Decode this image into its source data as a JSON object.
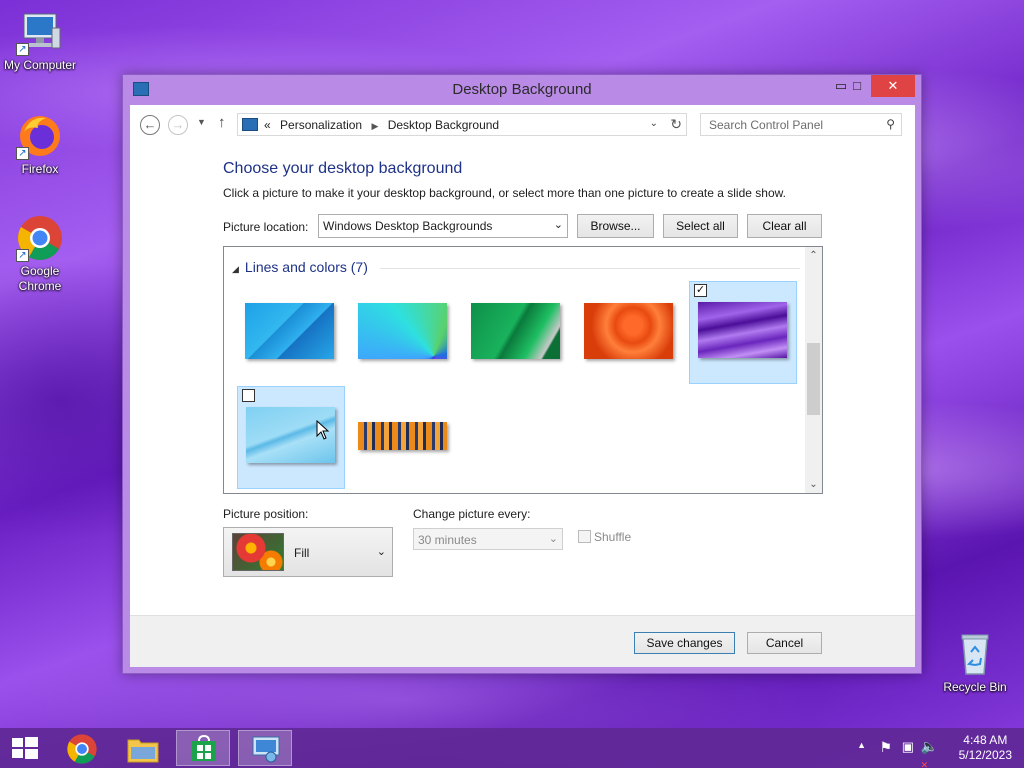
{
  "desktop": {
    "icons": [
      {
        "label": "My Computer"
      },
      {
        "label": "Firefox"
      },
      {
        "label": "Google Chrome"
      },
      {
        "label": "Recycle Bin"
      }
    ]
  },
  "window": {
    "title": "Desktop Background",
    "address": {
      "overflow": "«",
      "crumbs": [
        "Personalization",
        "Desktop Background"
      ]
    },
    "search": {
      "placeholder": "Search Control Panel"
    },
    "heading": "Choose your desktop background",
    "description": "Click a picture to make it your desktop background, or select more than one picture to create a slide show.",
    "picture_location": {
      "label": "Picture location:",
      "value": "Windows Desktop Backgrounds",
      "browse": "Browse...",
      "select_all": "Select all",
      "clear_all": "Clear all"
    },
    "gallery": {
      "group": "Lines and colors (7)",
      "items": [
        {
          "name": "blue-lines",
          "checked": false
        },
        {
          "name": "colorful-fan",
          "checked": false
        },
        {
          "name": "green-stripes",
          "checked": false
        },
        {
          "name": "orange-swirl",
          "checked": false
        },
        {
          "name": "purple-waves",
          "checked": true
        },
        {
          "name": "light-blue-curve",
          "checked": false
        },
        {
          "name": "orange-fence",
          "checked": false
        }
      ]
    },
    "picture_position": {
      "label": "Picture position:",
      "value": "Fill"
    },
    "change_picture": {
      "label": "Change picture every:",
      "value": "30 minutes"
    },
    "shuffle": {
      "label": "Shuffle",
      "checked": false
    },
    "buttons": {
      "save": "Save changes",
      "cancel": "Cancel"
    }
  },
  "taskbar": {
    "time": "4:48 AM",
    "date": "5/12/2023"
  },
  "colors": {
    "accent": "#1e3287",
    "close_button": "#e04343",
    "selection": "#cce8ff"
  }
}
